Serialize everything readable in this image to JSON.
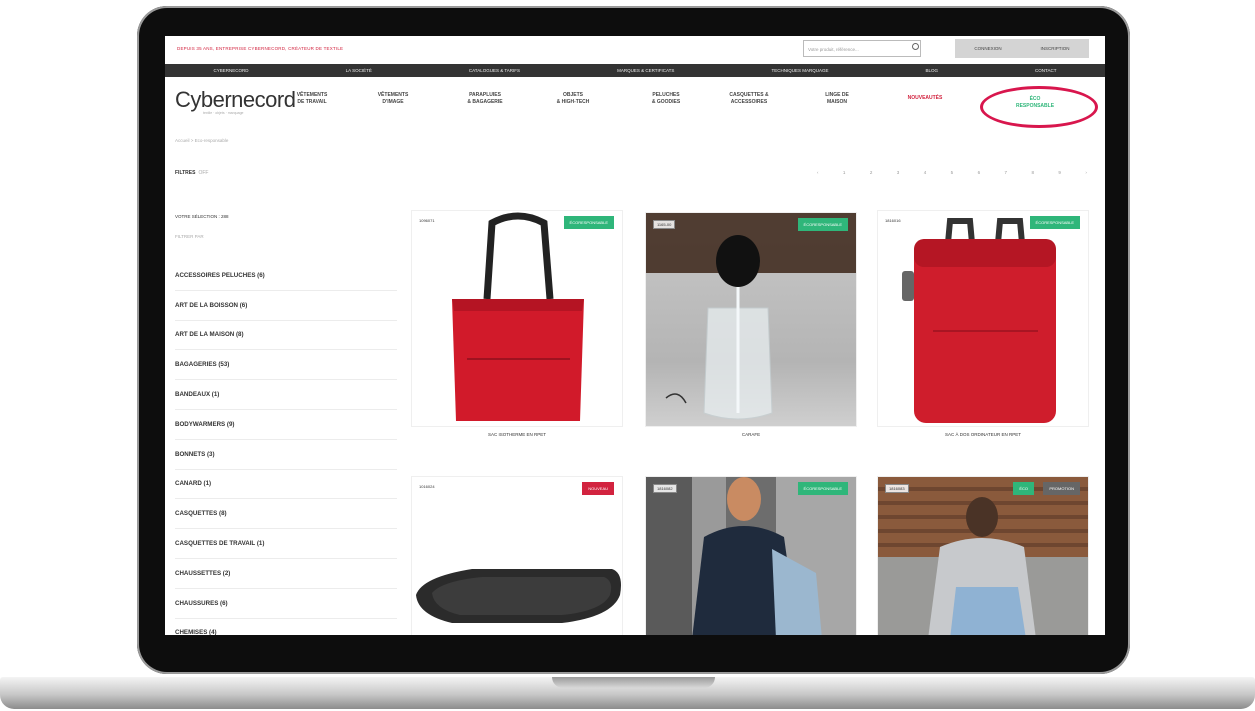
{
  "site": {
    "promo": "DEPUIS 35 ANS, ENTREPRISE CYBERNECORD, CRÉATEUR DE TEXTILE",
    "search_placeholder": "Votre produit, référence...",
    "auth": [
      "CONNEXION",
      "INSCRIPTION"
    ],
    "nav": [
      "CYBERNECORD",
      "LA SOCIÉTÉ",
      "CATALOGUES & TARIFS",
      "MARQUES & CERTIFICATS",
      "TECHNIQUES MARQUAGE",
      "BLOG",
      "CONTACT"
    ],
    "logo": "Cybernecord",
    "logo_sub": "textile · objets · marquage",
    "menu": [
      {
        "line1": "VÊTEMENTS",
        "line2": "DE TRAVAIL"
      },
      {
        "line1": "VÊTEMENTS",
        "line2": "D'IMAGE"
      },
      {
        "line1": "PARAPLUIES",
        "line2": "& BAGAGERIE"
      },
      {
        "line1": "OBJETS",
        "line2": "& HIGH-TECH"
      },
      {
        "line1": "PELUCHES",
        "line2": "& GOODIES"
      },
      {
        "line1": "CASQUETTES &",
        "line2": "ACCESSOIRES"
      },
      {
        "line1": "LINGE DE",
        "line2": "MAISON"
      }
    ],
    "menu_new": "NOUVEAUTÉS",
    "menu_eco": {
      "line1": "ÉCO",
      "line2": "RESPONSABLE"
    }
  },
  "breadcrumb": "Accueil  >  Eco-responsable",
  "filters": {
    "label": "FILTRES",
    "state": "OFF"
  },
  "pagination": [
    "‹",
    "1",
    "2",
    "3",
    "4",
    "5",
    "6",
    "7",
    "8",
    "9",
    "›"
  ],
  "sidebar": {
    "selection": "VOTRE SÉLECTION : 288",
    "filter_by": "FILTRER PAR",
    "categories": [
      "ACCESSOIRES PELUCHES (6)",
      "ART DE LA BOISSON (6)",
      "ART DE LA MAISON (8)",
      "BAGAGERIES (53)",
      "BANDEAUX (1)",
      "BODYWARMERS (9)",
      "BONNETS (3)",
      "CANARD (1)",
      "CASQUETTES (8)",
      "CASQUETTES DE TRAVAIL (1)",
      "CHAUSSETTES (2)",
      "CHAUSSURES (6)",
      "CHEMISES (4)"
    ]
  },
  "products": [
    {
      "ref": "1096071",
      "badge": "ÉCORESPONSABLE",
      "name": "SAC ISOTHERME EN RPET"
    },
    {
      "ref": "1165-00",
      "badge": "ÉCORESPONSABLE",
      "name": "CARAFE"
    },
    {
      "ref": "1816016",
      "badge": "ÉCORESPONSABLE",
      "name": "SAC À DOS ORDINATEUR EN RPET"
    },
    {
      "ref": "1016024",
      "badge": "NOUVEAU",
      "name": ""
    },
    {
      "ref": "1816082",
      "badge": "ÉCORESPONSABLE",
      "name": ""
    },
    {
      "ref": "1816083",
      "badge": "ÉCO",
      "badge2": "PROMOTION",
      "name": ""
    }
  ],
  "colors": {
    "brand_red": "#d2233f",
    "eco_green": "#2fb67a",
    "highlight_ring": "#d8164d"
  }
}
